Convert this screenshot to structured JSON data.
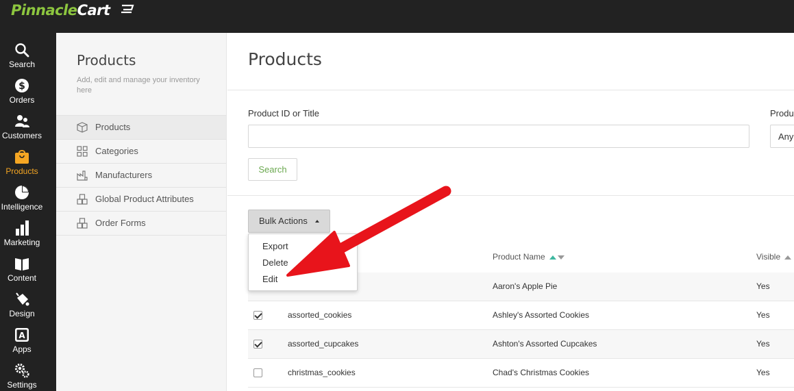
{
  "app": {
    "logo_part1": "Pinnacle",
    "logo_part2": "Cart"
  },
  "rail": {
    "items": [
      {
        "label": "Search",
        "icon": "search-icon"
      },
      {
        "label": "Orders",
        "icon": "dollar-icon"
      },
      {
        "label": "Customers",
        "icon": "users-icon"
      },
      {
        "label": "Products",
        "icon": "bag-icon",
        "active": true
      },
      {
        "label": "Intelligence",
        "icon": "pie-chart-icon"
      },
      {
        "label": "Marketing",
        "icon": "bar-chart-icon"
      },
      {
        "label": "Content",
        "icon": "book-icon"
      },
      {
        "label": "Design",
        "icon": "paint-bucket-icon"
      },
      {
        "label": "Apps",
        "icon": "apps-icon"
      },
      {
        "label": "Settings",
        "icon": "gears-icon"
      }
    ]
  },
  "subnav": {
    "title": "Products",
    "description": "Add, edit and manage your inventory here",
    "items": [
      {
        "label": "Products",
        "icon": "box-icon",
        "active": true
      },
      {
        "label": "Categories",
        "icon": "grid-icon"
      },
      {
        "label": "Manufacturers",
        "icon": "factory-icon"
      },
      {
        "label": "Global Product Attributes",
        "icon": "boxes-icon"
      },
      {
        "label": "Order Forms",
        "icon": "boxes-icon"
      }
    ]
  },
  "main": {
    "title": "Products",
    "filter": {
      "id_label": "Product ID or Title",
      "id_value": "",
      "second_label": "Produ",
      "second_value": "Any",
      "search_label": "Search"
    },
    "bulk_actions_label": "Bulk Actions",
    "bulk_menu": [
      "Export",
      "Delete",
      "Edit"
    ],
    "table": {
      "headers": {
        "name": "Product Name",
        "visible": "Visible"
      },
      "rows": [
        {
          "id": "",
          "name": "Aaron's Apple Pie",
          "visible": "Yes",
          "checked": false
        },
        {
          "id": "assorted_cookies",
          "name": "Ashley's Assorted Cookies",
          "visible": "Yes",
          "checked": true
        },
        {
          "id": "assorted_cupcakes",
          "name": "Ashton's Assorted Cupcakes",
          "visible": "Yes",
          "checked": true
        },
        {
          "id": "christmas_cookies",
          "name": "Chad's Christmas Cookies",
          "visible": "Yes",
          "checked": false
        }
      ]
    }
  },
  "colors": {
    "brand_green": "#8dc63f",
    "active_orange": "#f5a623",
    "dark_bg": "#222222",
    "sort_teal": "#3fb8a0",
    "annotation_red": "#e8141b"
  }
}
